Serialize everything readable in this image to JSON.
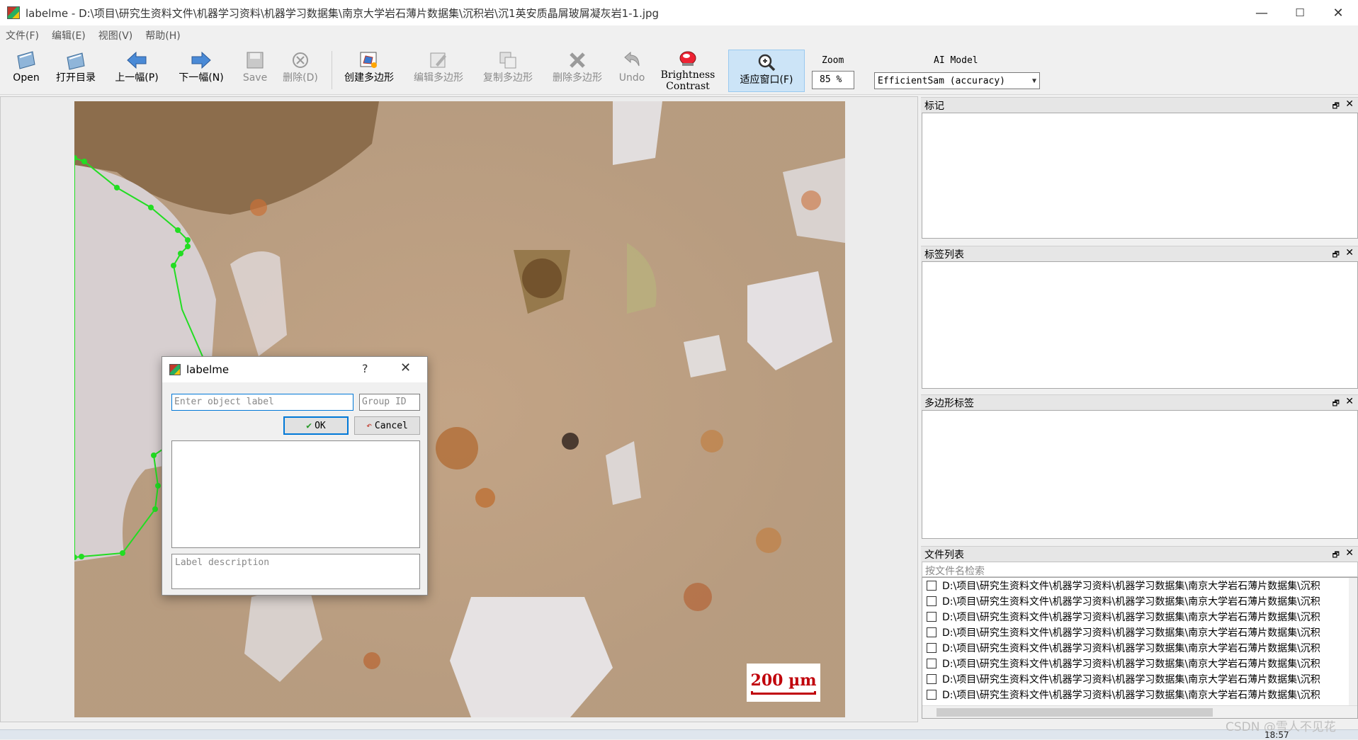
{
  "window": {
    "title": "labelme - D:\\项目\\研究生资料文件\\机器学习资料\\机器学习数据集\\南京大学岩石薄片数据集\\沉积岩\\沉1英安质晶屑玻屑凝灰岩1-1.jpg",
    "minimize": "—",
    "maximize": "☐",
    "close": "✕"
  },
  "menu": {
    "file": "文件(F)",
    "edit": "编辑(E)",
    "view": "视图(V)",
    "help": "帮助(H)"
  },
  "toolbar": {
    "open": "Open",
    "open_dir": "打开目录",
    "prev": "上一幅(P)",
    "next": "下一幅(N)",
    "save": "Save",
    "delete": "删除(D)",
    "create_polygon": "创建多边形",
    "edit_polygon": "编辑多边形",
    "copy_polygon": "复制多边形",
    "delete_polygon": "删除多边形",
    "undo": "Undo",
    "brightness_1": "Brightness",
    "brightness_2": "Contrast",
    "fit_window": "适应窗口(F)",
    "zoom_label": "Zoom",
    "zoom_value": "85 %",
    "ai_model_label": "AI Model",
    "ai_model_value": "EfficientSam (accuracy)"
  },
  "canvas": {
    "scale_label": "200 µm"
  },
  "dialog": {
    "title": "labelme",
    "help": "?",
    "close": "✕",
    "label_placeholder": "Enter object label",
    "group_placeholder": "Group ID",
    "ok": "OK",
    "cancel": "Cancel",
    "description_placeholder": "Label description"
  },
  "docks": {
    "flags": "标记",
    "label_list": "标签列表",
    "polygon_labels": "多边形标签",
    "file_list": "文件列表",
    "file_search_placeholder": "按文件名检索",
    "float_icon": "🗗",
    "close_icon": "✕"
  },
  "files": [
    "D:\\项目\\研究生资料文件\\机器学习资料\\机器学习数据集\\南京大学岩石薄片数据集\\沉积",
    "D:\\项目\\研究生资料文件\\机器学习资料\\机器学习数据集\\南京大学岩石薄片数据集\\沉积",
    "D:\\项目\\研究生资料文件\\机器学习资料\\机器学习数据集\\南京大学岩石薄片数据集\\沉积",
    "D:\\项目\\研究生资料文件\\机器学习资料\\机器学习数据集\\南京大学岩石薄片数据集\\沉积",
    "D:\\项目\\研究生资料文件\\机器学习资料\\机器学习数据集\\南京大学岩石薄片数据集\\沉积",
    "D:\\项目\\研究生资料文件\\机器学习资料\\机器学习数据集\\南京大学岩石薄片数据集\\沉积",
    "D:\\项目\\研究生资料文件\\机器学习资料\\机器学习数据集\\南京大学岩石薄片数据集\\沉积",
    "D:\\项目\\研究生资料文件\\机器学习资料\\机器学习数据集\\南京大学岩石薄片数据集\\沉积"
  ],
  "watermark": "CSDN @雪人不见花",
  "clock": "18:57",
  "colors": {
    "accent": "#0078d7",
    "polygon": "#22dd22",
    "scale": "#c0000a"
  }
}
